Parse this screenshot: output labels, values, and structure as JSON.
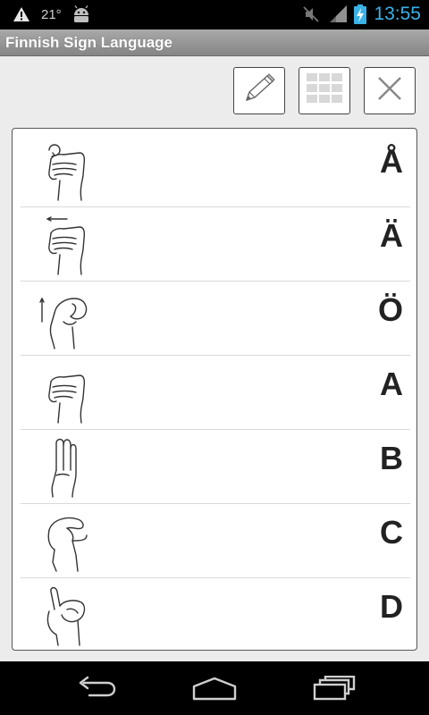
{
  "status_bar": {
    "temperature": "21°",
    "time": "13:55"
  },
  "app": {
    "title": "Finnish Sign Language"
  },
  "toolbar": {
    "buttons": [
      {
        "icon": "pencil-icon"
      },
      {
        "icon": "grid-icon"
      },
      {
        "icon": "close-icon"
      }
    ]
  },
  "signs": [
    {
      "letter": "Å"
    },
    {
      "letter": "Ä"
    },
    {
      "letter": "Ö"
    },
    {
      "letter": "A"
    },
    {
      "letter": "B"
    },
    {
      "letter": "C"
    },
    {
      "letter": "D"
    }
  ],
  "nav_bar": {
    "buttons": [
      {
        "icon": "back-icon"
      },
      {
        "icon": "home-icon"
      },
      {
        "icon": "recent-apps-icon"
      }
    ]
  }
}
